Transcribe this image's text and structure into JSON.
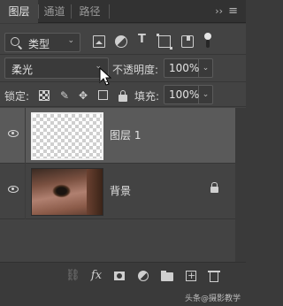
{
  "tabs": [
    {
      "label": "图层",
      "active": true
    },
    {
      "label": "通道",
      "active": false
    },
    {
      "label": "路径",
      "active": false
    }
  ],
  "tabbar": {
    "collapse_icon": "double-chevron-right-icon",
    "menu_icon": "hamburger-menu-icon",
    "collapse_glyph": "››",
    "menu_glyph": "≡"
  },
  "filter": {
    "kind_label": "类型",
    "chevron": "⌄",
    "icons": [
      "image-filter-icon",
      "adjustment-filter-icon",
      "type-filter-icon",
      "shape-filter-icon",
      "smart-object-filter-icon",
      "filter-toggle-icon"
    ],
    "type_glyph": "T"
  },
  "blend": {
    "mode": "柔光",
    "chevron": "⌄",
    "opacity_label": "不透明度:",
    "opacity_value": "100%"
  },
  "lock": {
    "label": "锁定:",
    "brush_glyph": "✎",
    "move_glyph": "✥",
    "fill_label": "填充:",
    "fill_value": "100%"
  },
  "layers": [
    {
      "name": "图层 1",
      "selected": true,
      "visible": true,
      "thumbnail": "transparent",
      "locked": false
    },
    {
      "name": "背景",
      "selected": false,
      "visible": true,
      "thumbnail": "eye-photo",
      "locked": true
    }
  ],
  "bottom_bar": {
    "icons": [
      "link-layers-icon",
      "fx-icon",
      "add-mask-icon",
      "new-adjustment-layer-icon",
      "new-group-icon",
      "new-layer-icon",
      "delete-layer-icon"
    ],
    "link_glyph": "⛓",
    "fx_glyph": "fx",
    "watermark": "头条@摄影教学"
  },
  "colors": {
    "panel_bg": "#434343",
    "selected_row": "#5a5a5a",
    "tabbar_bg": "#323232"
  }
}
